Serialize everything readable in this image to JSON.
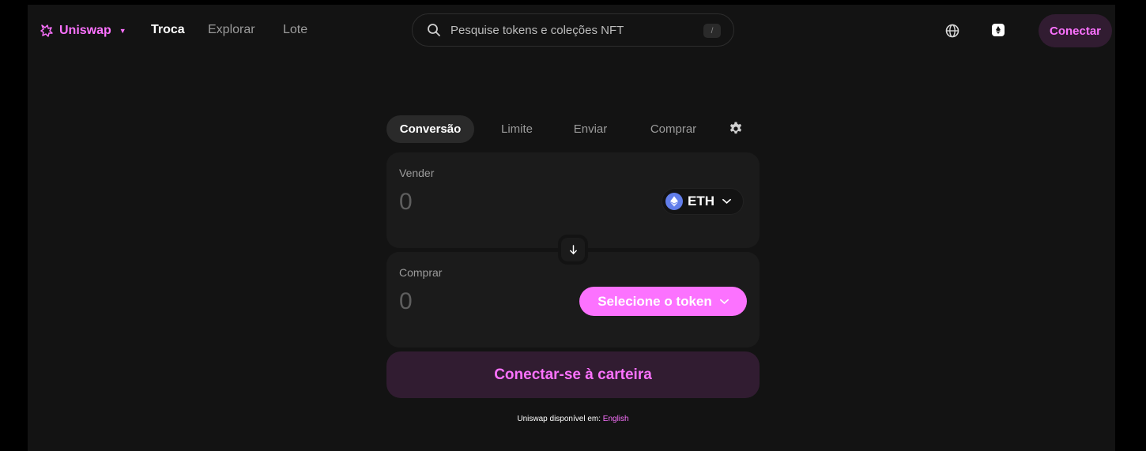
{
  "header": {
    "brand": "Uniswap",
    "nav": [
      {
        "label": "Troca",
        "active": true
      },
      {
        "label": "Explorar",
        "active": false
      },
      {
        "label": "Lote",
        "active": false
      }
    ],
    "search": {
      "placeholder": "Pesquise tokens e coleções NFT",
      "shortcut": "/"
    },
    "connect_label": "Conectar"
  },
  "swap": {
    "tabs": [
      {
        "label": "Conversão",
        "active": true
      },
      {
        "label": "Limite",
        "active": false
      },
      {
        "label": "Enviar",
        "active": false
      },
      {
        "label": "Comprar",
        "active": false
      }
    ],
    "sell": {
      "label": "Vender",
      "amount": "0",
      "token": "ETH"
    },
    "buy": {
      "label": "Comprar",
      "amount": "0",
      "select_label": "Selecione o token"
    },
    "wallet_button": "Conectar-se à carteira"
  },
  "footer": {
    "text": "Uniswap disponível em:",
    "language_link": "English"
  },
  "colors": {
    "accent": "#FC72FF",
    "accent_bg": "#311C31",
    "page_bg": "#131313",
    "panel_bg": "#1B1B1B",
    "eth_blue": "#627EEA"
  },
  "icons": [
    "unicorn-logo-icon",
    "search-icon",
    "globe-icon",
    "eth-square-icon",
    "gear-icon",
    "eth-icon",
    "chevron-down-icon",
    "arrow-down-icon"
  ]
}
